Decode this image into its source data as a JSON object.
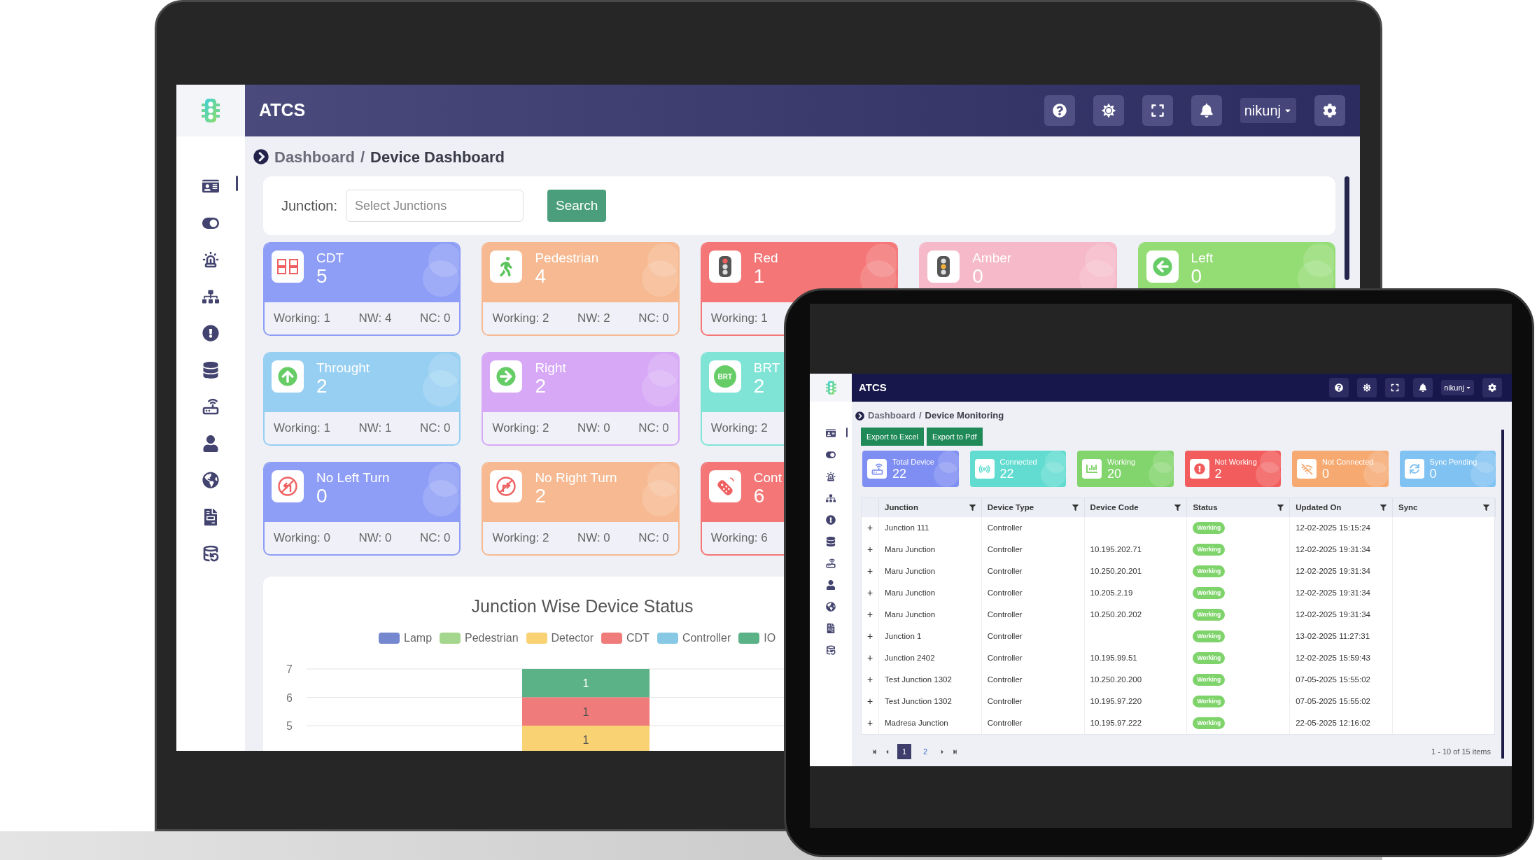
{
  "laptop": {
    "app": {
      "title": "ATCS",
      "user": "nikunj"
    },
    "sidebar": {
      "items": [
        {
          "selected": true
        },
        {
          "selected": false
        },
        {
          "selected": false
        },
        {
          "selected": false
        },
        {
          "selected": false
        },
        {
          "selected": false
        },
        {
          "selected": false
        },
        {
          "selected": false
        },
        {
          "selected": false
        },
        {
          "selected": false
        },
        {
          "selected": false
        }
      ]
    },
    "breadcrumb": {
      "items": [
        "Dashboard",
        "Device Dashboard"
      ],
      "separator": "/"
    },
    "filter": {
      "label": "Junction:",
      "placeholder": "Select Junctions",
      "button": "Search"
    },
    "card_rows": [
      [
        {
          "kind": "cdt",
          "label": "CDT",
          "value": "5",
          "color": "#8e9ef6",
          "stats": [
            "Working: 1",
            "NW: 4",
            "NC: 0"
          ]
        },
        {
          "kind": "pedestrian",
          "label": "Pedestrian",
          "value": "4",
          "color": "#f6b991",
          "stats": [
            "Working: 2",
            "NW: 2",
            "NC: 0"
          ]
        },
        {
          "kind": "signal-red",
          "label": "Red",
          "value": "1",
          "color": "#f47676",
          "stats": [
            "Working: 1"
          ]
        },
        {
          "kind": "signal-amber",
          "label": "Amber",
          "value": "0",
          "color": "#f6b9c9"
        },
        {
          "kind": "arrow-left",
          "label": "Left",
          "value": "0",
          "color": "#94dc74"
        }
      ],
      [
        {
          "kind": "arrow-up",
          "label": "Throught",
          "value": "2",
          "color": "#97cff2",
          "stats": [
            "Working: 1",
            "NW: 1",
            "NC: 0"
          ]
        },
        {
          "kind": "arrow-right",
          "label": "Right",
          "value": "2",
          "color": "#d6a8f6",
          "stats": [
            "Working: 2",
            "NW: 0",
            "NC: 0"
          ]
        },
        {
          "kind": "brt",
          "label": "BRT",
          "icon_text": "BRT",
          "value": "2",
          "color": "#7fe4d5",
          "stats": [
            "Working: 2"
          ]
        }
      ],
      [
        {
          "kind": "no-left",
          "label": "No Left Turn",
          "value": "0",
          "color": "#8e9ef6",
          "stats": [
            "Working: 0",
            "NW: 0",
            "NC: 0"
          ]
        },
        {
          "kind": "no-right",
          "label": "No Right Turn",
          "value": "2",
          "color": "#f6b991",
          "stats": [
            "Working: 2",
            "NW: 0",
            "NC: 0"
          ]
        },
        {
          "kind": "controller",
          "label": "Cont",
          "value": "6",
          "color": "#f47676",
          "stats": [
            "Working: 6"
          ]
        }
      ]
    ],
    "chart": {
      "title": "Junction Wise Device Status",
      "legend": [
        {
          "name": "Lamp",
          "color": "#7587cf"
        },
        {
          "name": "Pedestrian",
          "color": "#a5d68e"
        },
        {
          "name": "Detector",
          "color": "#f9d274"
        },
        {
          "name": "CDT",
          "color": "#ef7c7b"
        },
        {
          "name": "Controller",
          "color": "#87c9e5"
        },
        {
          "name": "IO",
          "color": "#5bb286"
        }
      ],
      "y_tick_labels": [
        "7",
        "6",
        "5"
      ],
      "segments": [
        {
          "color": "#5bb286",
          "label": "1"
        },
        {
          "color": "#ef7c7b",
          "label": "1"
        },
        {
          "color": "#f9d274",
          "label": "1"
        }
      ]
    }
  },
  "tablet": {
    "app": {
      "title": "ATCS",
      "user": "nikunj"
    },
    "sidebar": {
      "items": [
        {
          "selected": true
        },
        {
          "selected": false
        },
        {
          "selected": false
        },
        {
          "selected": false
        },
        {
          "selected": false
        },
        {
          "selected": false
        },
        {
          "selected": false
        },
        {
          "selected": false
        },
        {
          "selected": false
        },
        {
          "selected": false
        },
        {
          "selected": false
        }
      ]
    },
    "breadcrumb": {
      "items": [
        "Dashboard",
        "Device Monitoring"
      ],
      "separator": "/"
    },
    "export_buttons": [
      "Export to Excel",
      "Export to Pdf"
    ],
    "stats": [
      {
        "kind": "router",
        "label": "Total Device",
        "value": "22",
        "color": "#7e8ef2"
      },
      {
        "kind": "broadcast",
        "label": "Connected",
        "value": "22",
        "color": "#62dcd0"
      },
      {
        "kind": "bars",
        "label": "Working",
        "value": "20",
        "color": "#82d46c"
      },
      {
        "kind": "alert",
        "label": "Not Working",
        "value": "2",
        "color": "#f25c5c"
      },
      {
        "kind": "offline",
        "label": "Not Connected",
        "value": "0",
        "color": "#f6aa72"
      },
      {
        "kind": "sync",
        "label": "Sync Pending",
        "value": "0",
        "color": "#80c2f2"
      }
    ],
    "table": {
      "columns": [
        "Junction",
        "Device Type",
        "Device Code",
        "Status",
        "Updated On",
        "Sync"
      ],
      "rows": [
        {
          "expand": "+",
          "junction": "Junction 111",
          "device_type": "Controller",
          "status": "Working",
          "updated_on": "12-02-2025 15:15:24"
        },
        {
          "expand": "+",
          "junction": "Maru Junction",
          "device_type": "Controller",
          "device_code": "10.195.202.71",
          "status": "Working",
          "updated_on": "12-02-2025 19:31:34"
        },
        {
          "expand": "+",
          "junction": "Maru Junction",
          "device_type": "Controller",
          "device_code": "10.250.20.201",
          "status": "Working",
          "updated_on": "12-02-2025 19:31:34"
        },
        {
          "expand": "+",
          "junction": "Maru Junction",
          "device_type": "Controller",
          "device_code": "10.205.2.19",
          "status": "Working",
          "updated_on": "12-02-2025 19:31:34"
        },
        {
          "expand": "+",
          "junction": "Maru Junction",
          "device_type": "Controller",
          "device_code": "10.250.20.202",
          "status": "Working",
          "updated_on": "12-02-2025 19:31:34"
        },
        {
          "expand": "+",
          "junction": "Junction 1",
          "device_type": "Controller",
          "status": "Working",
          "updated_on": "13-02-2025 11:27:31"
        },
        {
          "expand": "+",
          "junction": "Junction 2402",
          "device_type": "Controller",
          "device_code": "10.195.99.51",
          "status": "Working",
          "updated_on": "12-02-2025 15:59:43"
        },
        {
          "expand": "+",
          "junction": "Test Junction 1302",
          "device_type": "Controller",
          "device_code": "10.250.20.200",
          "status": "Working",
          "updated_on": "07-05-2025 15:55:02"
        },
        {
          "expand": "+",
          "junction": "Test Junction 1302",
          "device_type": "Controller",
          "device_code": "10.195.97.220",
          "status": "Working",
          "updated_on": "07-05-2025 15:55:02"
        },
        {
          "expand": "+",
          "junction": "Madresa Junction",
          "device_type": "Controller",
          "device_code": "10.195.97.222",
          "status": "Working",
          "updated_on": "22-05-2025 12:16:02"
        }
      ]
    },
    "pagination": {
      "pages": [
        {
          "label": "1",
          "selected": true
        },
        {
          "label": "2",
          "selected": false
        }
      ],
      "summary": "1 - 10 of 15 items"
    }
  }
}
